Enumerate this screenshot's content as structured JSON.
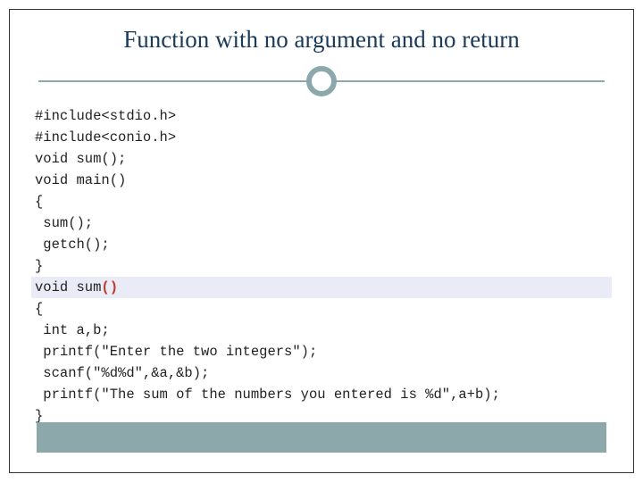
{
  "slide": {
    "title": "Function with no argument and no return",
    "code": {
      "l1": "#include<stdio.h>",
      "l2": "#include<conio.h>",
      "l3": "void sum();",
      "l4": "void main()",
      "l5": "{",
      "l6": " sum();",
      "l7": " getch();",
      "l8": "}",
      "l9a": "void sum",
      "l9b": "()",
      "l10": "{",
      "l11": " int a,b;",
      "l12": " printf(\"Enter the two integers\");",
      "l13": " scanf(\"%d%d\",&a,&b);",
      "l14": " printf(\"The sum of the numbers you entered is %d\",a+b);",
      "l15": "}"
    }
  }
}
